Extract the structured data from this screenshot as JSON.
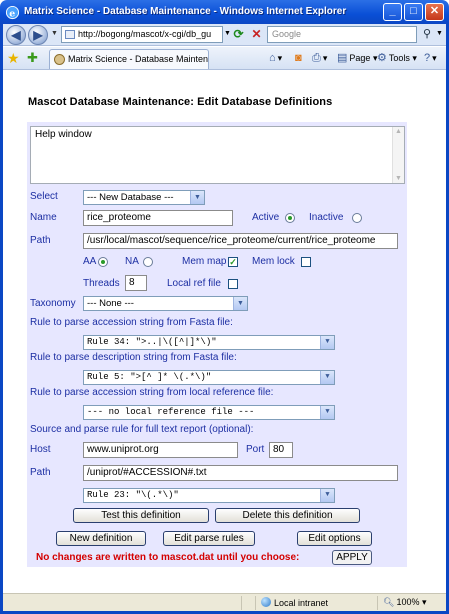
{
  "window": {
    "title": "Matrix Science - Database Maintenance - Windows Internet Explorer",
    "address": "http://bogong/mascot/x-cgi/db_gu",
    "search_placeholder": "Google",
    "tab_title": "Matrix Science - Database Maintenance",
    "toolbar": {
      "page": "Page",
      "tools": "Tools"
    }
  },
  "page": {
    "title": "Mascot Database Maintenance: Edit Database Definitions",
    "help_text": "Help window",
    "select_label": "Select",
    "select_value": "--- New Database ---",
    "name_label": "Name",
    "name_value": "rice_proteome",
    "active_label": "Active",
    "inactive_label": "Inactive",
    "path_label": "Path",
    "path_value": "/usr/local/mascot/sequence/rice_proteome/current/rice_proteome",
    "aa_label": "AA",
    "na_label": "NA",
    "memmap_label": "Mem map",
    "memlock_label": "Mem lock",
    "threads_label": "Threads",
    "threads_value": "8",
    "localref_label": "Local ref file",
    "taxonomy_label": "Taxonomy",
    "taxonomy_value": "--- None ---",
    "rule_accession_label": "Rule to parse accession string from Fasta file:",
    "rule_accession_value": "Rule 34: \">..|\\([^|]*\\)\"",
    "rule_description_label": "Rule to parse description string from Fasta file:",
    "rule_description_value": "Rule 5: \">[^ ]* \\(.*\\)\"",
    "rule_localref_label": "Rule to parse accession string from local reference file:",
    "rule_localref_value": "--- no local reference file ---",
    "report_label": "Source and parse rule for full text report (optional):",
    "host_label": "Host",
    "host_value": "www.uniprot.org",
    "port_label": "Port",
    "port_value": "80",
    "path2_label": "Path",
    "path2_value": "/uniprot/#ACCESSION#.txt",
    "rule_report_value": "Rule 23: \"\\(.*\\)\"",
    "test_button": "Test this definition",
    "delete_button": "Delete this definition",
    "new_button": "New definition",
    "edit_parse_button": "Edit parse rules",
    "edit_options_button": "Edit options",
    "notice": "No changes are written to mascot.dat until you choose:",
    "apply_button": "APPLY"
  },
  "status": {
    "zone": "Local intranet",
    "zoom": "100%"
  }
}
